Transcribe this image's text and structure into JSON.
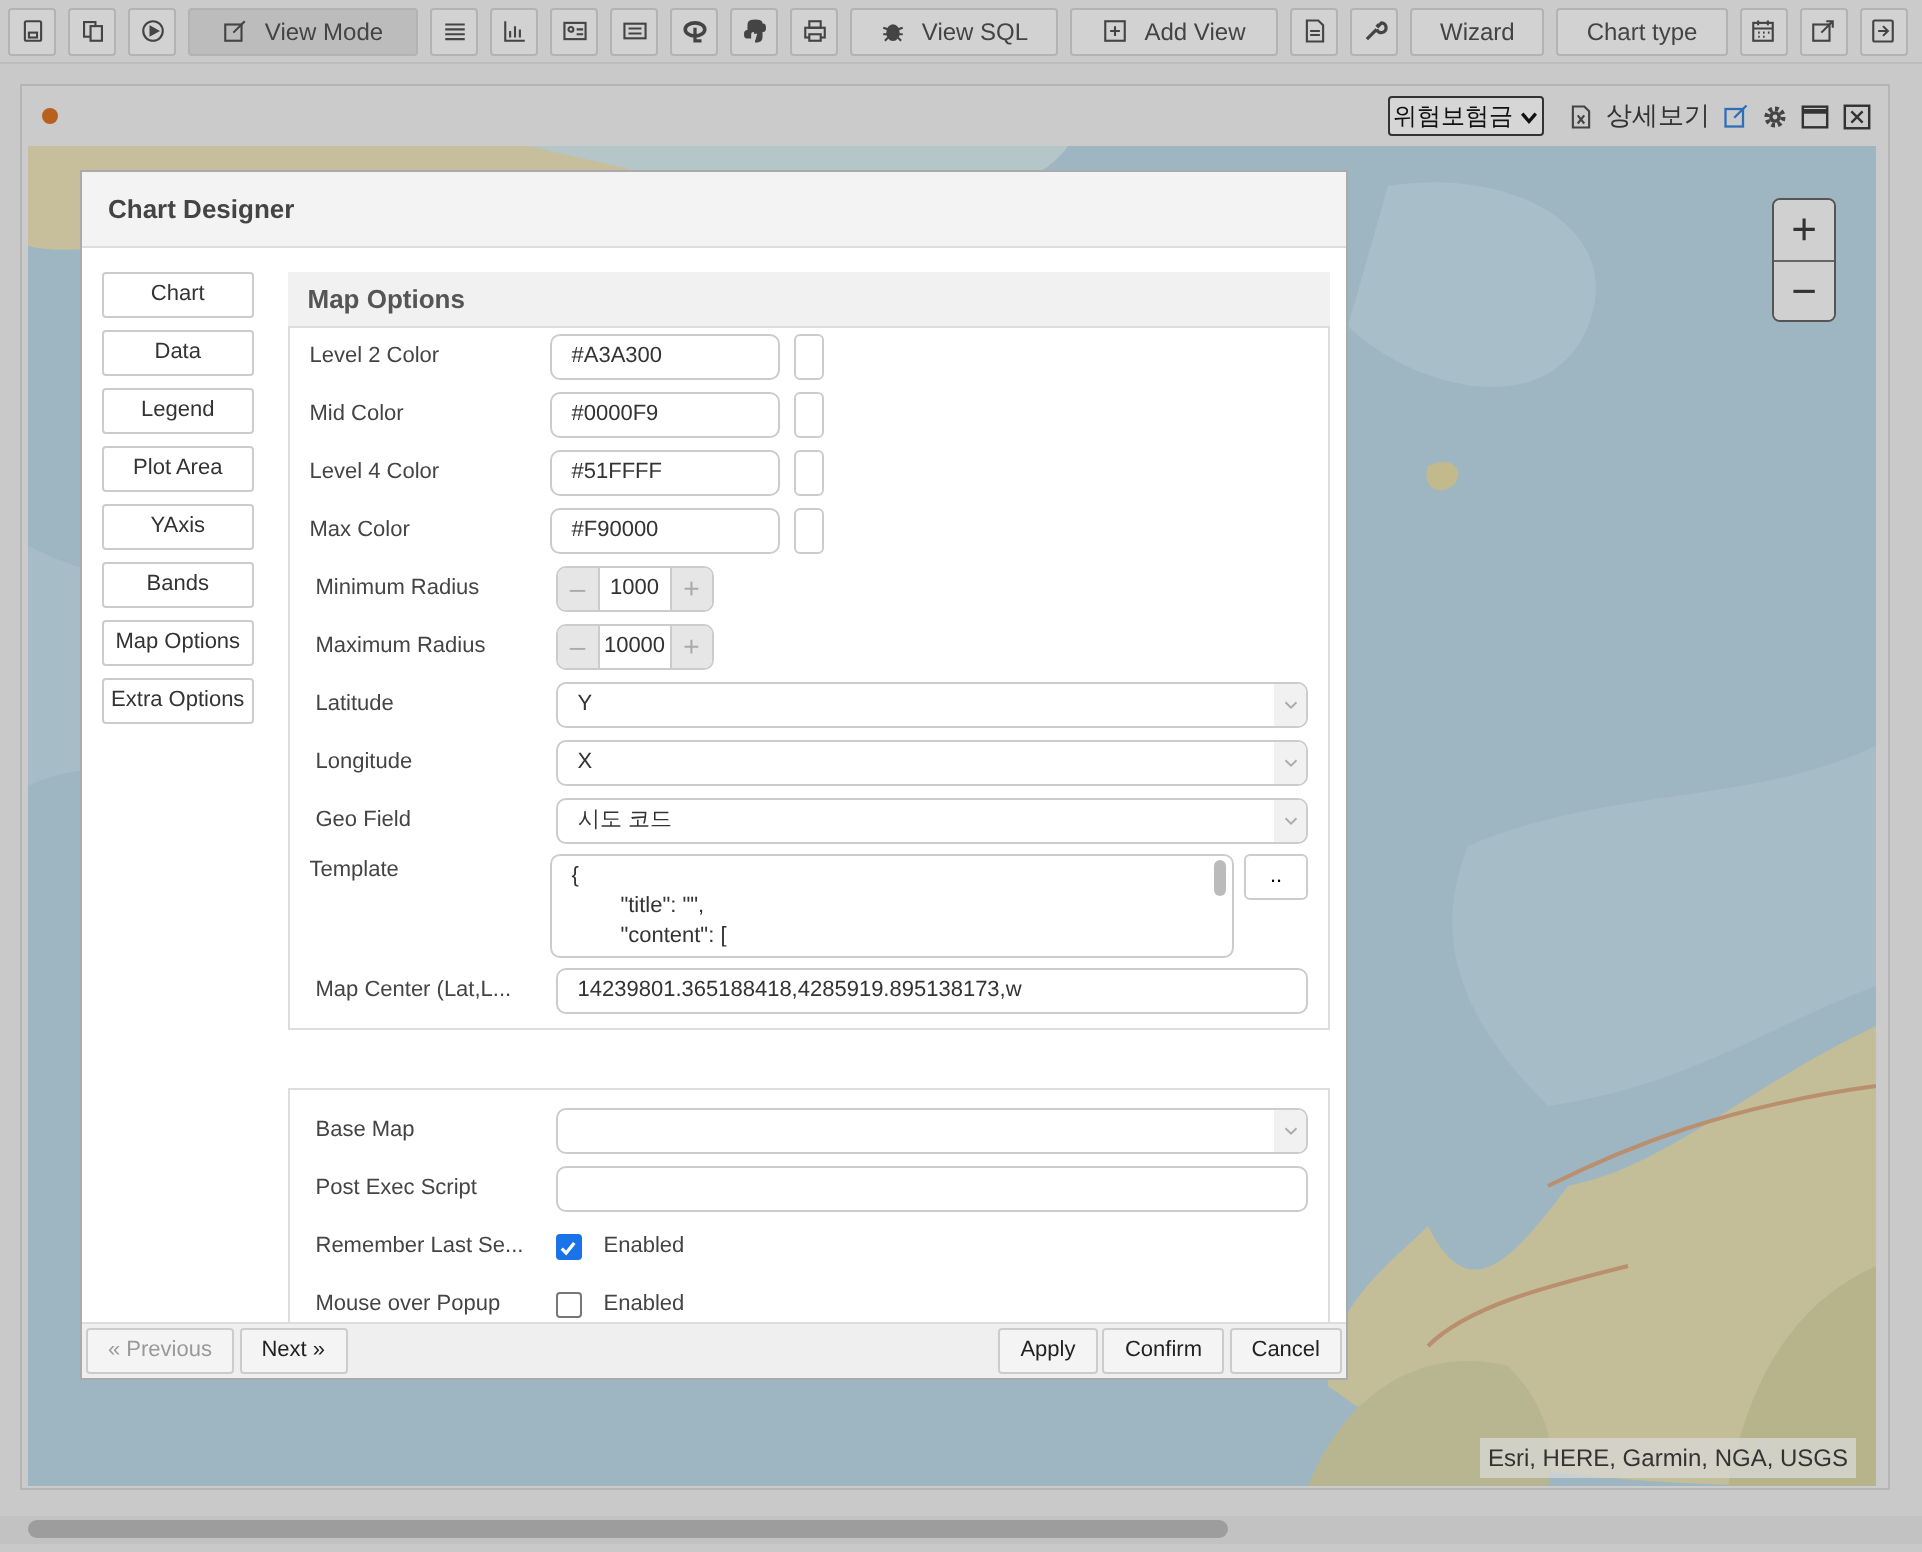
{
  "toolbar": [
    {
      "kind": "icon",
      "selected": false
    },
    {
      "kind": "icon",
      "selected": false
    },
    {
      "kind": "icon",
      "selected": false
    },
    {
      "kind": "text",
      "label": "View Mode",
      "selected": true
    },
    {
      "kind": "icon",
      "selected": false
    },
    {
      "kind": "icon",
      "selected": false
    },
    {
      "kind": "icon",
      "selected": false
    },
    {
      "kind": "icon",
      "selected": false
    },
    {
      "kind": "icon",
      "selected": false
    },
    {
      "kind": "icon",
      "selected": false
    },
    {
      "kind": "icon",
      "selected": false
    },
    {
      "kind": "text",
      "label": "View SQL",
      "selected": false
    },
    {
      "kind": "text",
      "label": "Add View",
      "selected": false
    },
    {
      "kind": "icon",
      "selected": false
    },
    {
      "kind": "icon",
      "selected": false
    },
    {
      "kind": "text",
      "label": "Wizard",
      "selected": false
    },
    {
      "kind": "text",
      "label": "Chart type",
      "selected": false
    },
    {
      "kind": "icon",
      "selected": false
    },
    {
      "kind": "icon",
      "selected": false
    },
    {
      "kind": "icon",
      "selected": false
    }
  ],
  "panel": {
    "measure": "위험보험금",
    "detail_label": "상세보기"
  },
  "map": {
    "zoom_in": "+",
    "zoom_out": "−",
    "attribution": "Esri, HERE, Garmin, NGA, USGS"
  },
  "dialog": {
    "title": "Chart Designer",
    "nav": [
      {
        "label": "Chart"
      },
      {
        "label": "Data"
      },
      {
        "label": "Legend"
      },
      {
        "label": "Plot Area"
      },
      {
        "label": "YAxis"
      },
      {
        "label": "Bands"
      },
      {
        "label": "Map Options"
      },
      {
        "label": "Extra Options"
      }
    ],
    "section_title": "Map Options",
    "fields": [
      {
        "kind": "color",
        "label": "Level 2 Color",
        "value": "#A3A300"
      },
      {
        "kind": "color",
        "label": "Mid Color",
        "value": "#0000F9"
      },
      {
        "kind": "color",
        "label": "Level 4 Color",
        "value": "#51FFFF"
      },
      {
        "kind": "color",
        "label": "Max Color",
        "value": "#F90000"
      },
      {
        "kind": "spinner",
        "label": "Minimum Radius",
        "value": "1000",
        "minus": "–",
        "plus": "+"
      },
      {
        "kind": "spinner",
        "label": "Maximum Radius",
        "value": "10000",
        "minus": "–",
        "plus": "+"
      },
      {
        "kind": "select",
        "label": "Latitude",
        "value": "Y"
      },
      {
        "kind": "select",
        "label": "Longitude",
        "value": "X"
      },
      {
        "kind": "select",
        "label": "Geo Field",
        "value": "시도 코드"
      },
      {
        "kind": "textarea",
        "label": "Template",
        "lines": [
          "{",
          "        \"title\": \"\",",
          "        \"content\": ["
        ],
        "button": ".."
      },
      {
        "kind": "text",
        "label": "Map Center (Lat,L...",
        "value": "14239801.365188418,4285919.895138173,w"
      }
    ],
    "extra_fields": [
      {
        "kind": "select",
        "label": "Base Map"
      },
      {
        "kind": "text",
        "label": "Post Exec Script"
      },
      {
        "kind": "checkbox",
        "label": "Remember Last Se...",
        "checked": true,
        "option": "Enabled"
      },
      {
        "kind": "checkbox",
        "label": "Mouse over Popup",
        "checked": false,
        "option": "Enabled"
      }
    ],
    "footer_left": [
      {
        "label": "« Previous",
        "disabled": true
      },
      {
        "label": "Next »",
        "disabled": false
      }
    ],
    "footer_right": [
      {
        "label": "Apply",
        "disabled": false
      },
      {
        "label": "Confirm",
        "disabled": false
      },
      {
        "label": "Cancel",
        "disabled": false
      }
    ]
  }
}
